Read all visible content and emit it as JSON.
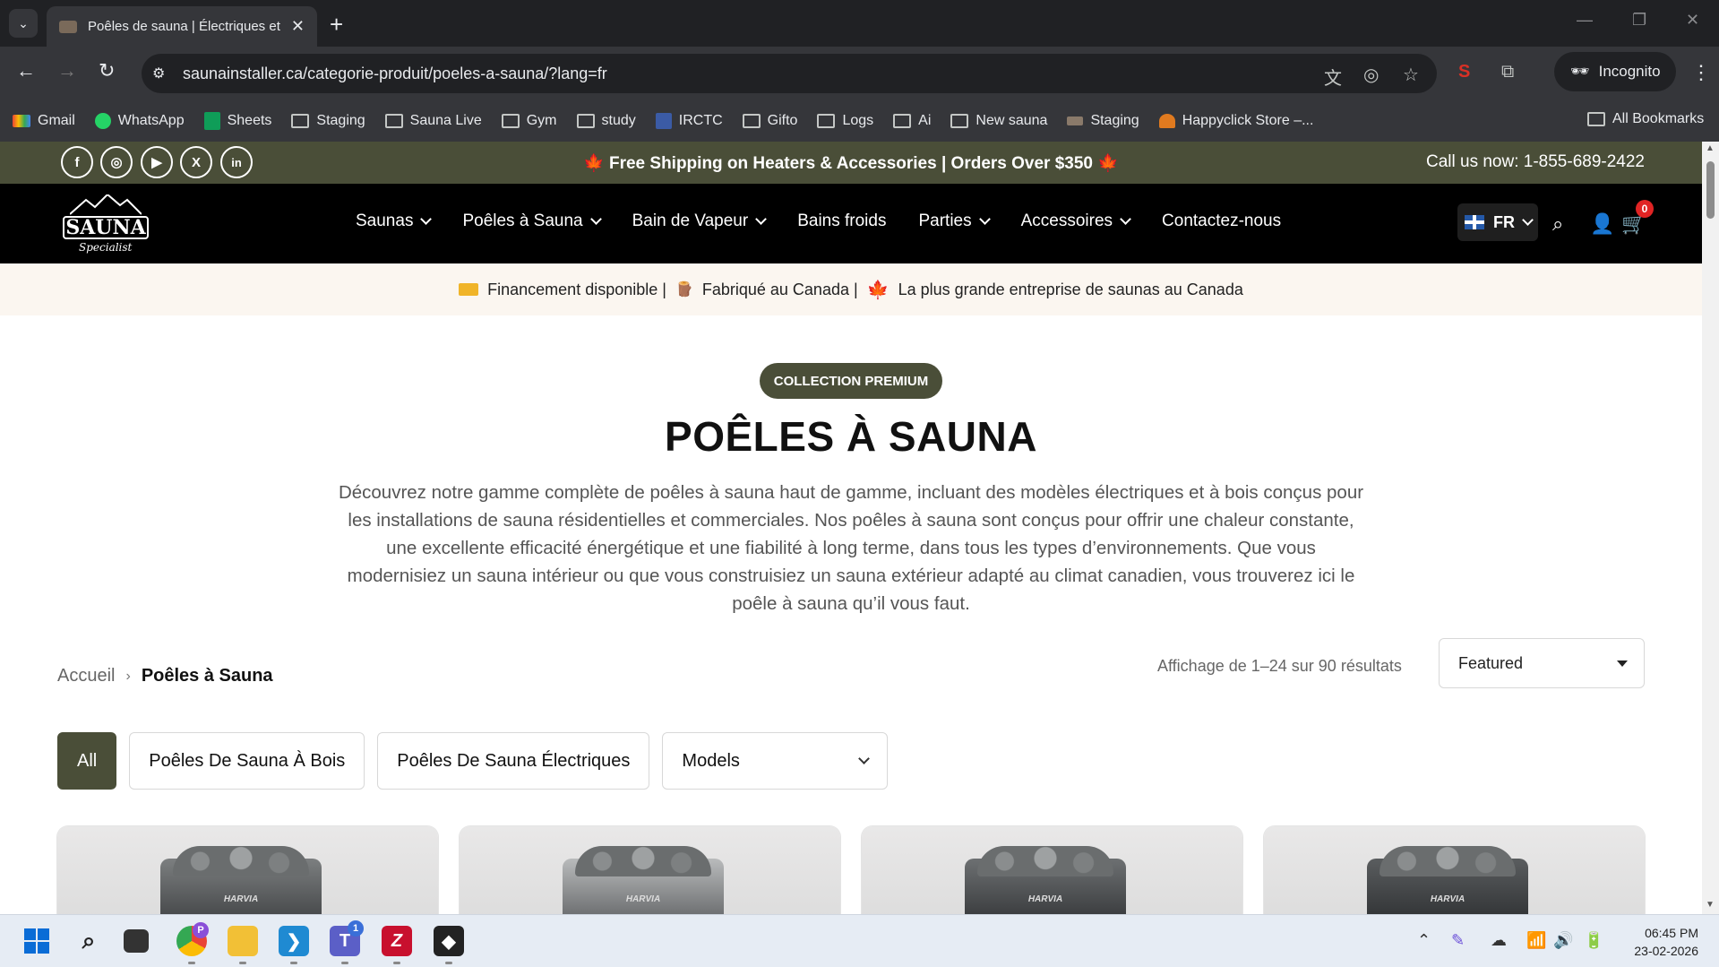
{
  "browser": {
    "tab_title": "Poêles de sauna | Électriques et",
    "tab_close": "✕",
    "new_tab": "+",
    "url": "saunainstaller.ca/categorie-produit/poeles-a-sauna/?lang=fr",
    "incognito_label": "Incognito",
    "bookmarks": [
      {
        "label": "Gmail",
        "icon": "gmail-icon"
      },
      {
        "label": "WhatsApp",
        "icon": "whatsapp-icon"
      },
      {
        "label": "Sheets",
        "icon": "sheets-icon"
      },
      {
        "label": "Staging",
        "icon": "folder-icon"
      },
      {
        "label": "Sauna Live",
        "icon": "folder-icon"
      },
      {
        "label": "Gym",
        "icon": "folder-icon"
      },
      {
        "label": "study",
        "icon": "folder-icon"
      },
      {
        "label": "IRCTC",
        "icon": "irctc-icon"
      },
      {
        "label": "Gifto",
        "icon": "folder-icon"
      },
      {
        "label": "Logs",
        "icon": "folder-icon"
      },
      {
        "label": "Ai",
        "icon": "folder-icon"
      },
      {
        "label": "New sauna",
        "icon": "folder-icon"
      },
      {
        "label": "Staging",
        "icon": "site-icon"
      },
      {
        "label": "Happyclick Store –...",
        "icon": "store-icon"
      }
    ],
    "all_bookmarks": "All Bookmarks"
  },
  "topbar": {
    "promo": "Free Shipping on Heaters & Accessories | Orders Over $350",
    "leaf": "🍁",
    "callus": "Call us now: 1-855-689-2422"
  },
  "header": {
    "logo_word": "SAUNA",
    "logo_script": "Specialist",
    "nav": [
      {
        "label": "Saunas",
        "dropdown": true
      },
      {
        "label": "Poêles à Sauna",
        "dropdown": true
      },
      {
        "label": "Bain de Vapeur",
        "dropdown": true
      },
      {
        "label": "Bains froids",
        "dropdown": false
      },
      {
        "label": "Parties",
        "dropdown": true
      },
      {
        "label": "Accessoires",
        "dropdown": true
      },
      {
        "label": "Contactez-nous",
        "dropdown": false
      }
    ],
    "lang": "FR",
    "cart_count": "0"
  },
  "infobar": {
    "financing": "Financement disponible |",
    "made_in": "Fabriqué au Canada |",
    "largest": "La plus grande entreprise de saunas au Canada"
  },
  "hero": {
    "badge": "COLLECTION PREMIUM",
    "title": "POÊLES À SAUNA",
    "intro": "Découvrez notre gamme complète de poêles à sauna haut de gamme, incluant des modèles électriques et à bois conçus pour les installations de sauna résidentielles et commerciales. Nos poêles à sauna sont conçus pour offrir une chaleur constante, une excellente efficacité énergétique et une fiabilité à long terme, dans tous les types d’environnements. Que vous modernisiez un sauna intérieur ou que vous construisiez un sauna extérieur adapté au climat canadien, vous trouverez ici le poêle à sauna qu’il vous faut."
  },
  "listing": {
    "breadcrumb_home": "Accueil",
    "breadcrumb_sep": "›",
    "breadcrumb_current": "Poêles à Sauna",
    "result_count": "Affichage de 1–24 sur 90 résultats",
    "sort_selected": "Featured",
    "filters": {
      "all": "All",
      "wood": "Poêles De Sauna À Bois",
      "electric": "Poêles De Sauna Électriques",
      "models": "Models"
    },
    "product_brand": "HARVIA"
  },
  "taskbar": {
    "chrome_badge": "P",
    "teams_badge": "1",
    "time": "06:45 PM",
    "date": "23-02-2026"
  },
  "colors": {
    "olive": "#4a4e38",
    "header_black": "#000000",
    "cart_badge": "#e02424",
    "infobar_bg": "#fbf6f0"
  }
}
